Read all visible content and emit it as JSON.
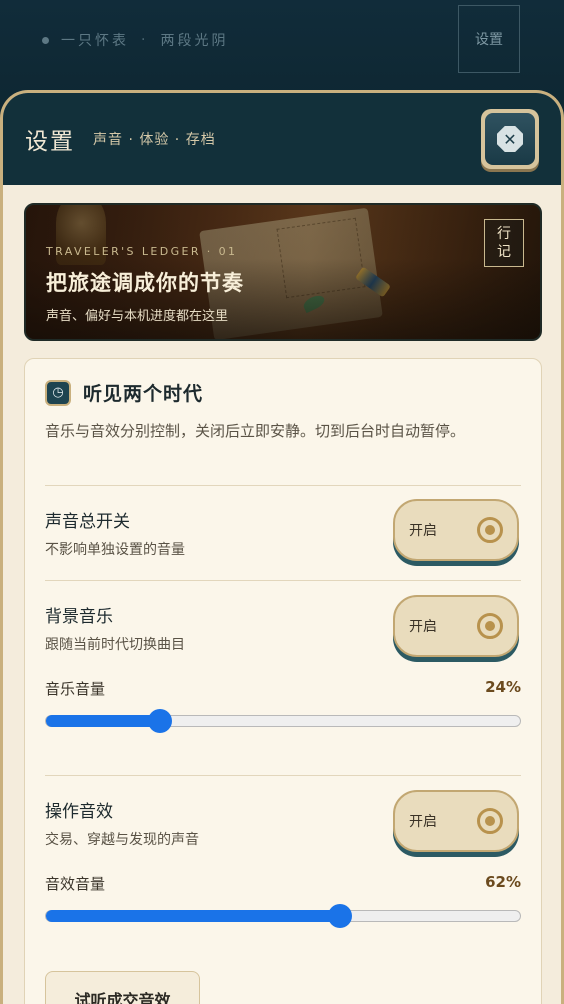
{
  "topbar": {
    "crumb_a": "一只怀表",
    "crumb_sep": "·",
    "crumb_b": "两段光阴",
    "settings_label": "设置"
  },
  "sheet": {
    "title": "设置",
    "subtitle": "声音 · 体验 · 存档",
    "close_icon": "close-icon"
  },
  "banner": {
    "eyebrow": "TRAVELER'S LEDGER · 01",
    "headline": "把旅途调成你的节奏",
    "desc": "声音、偏好与本机进度都在这里",
    "stamp_top": "行",
    "stamp_bottom": "记"
  },
  "card": {
    "title": "听见两个时代",
    "desc": "音乐与音效分别控制，关闭后立即安静。切到后台时自动暂停。",
    "master": {
      "title": "声音总开关",
      "sub": "不影响单独设置的音量",
      "toggle_label": "开启"
    },
    "music": {
      "title": "背景音乐",
      "sub": "跟随当前时代切换曲目",
      "toggle_label": "开启",
      "volume_label": "音乐音量",
      "volume_text": "24%",
      "volume": 0.24
    },
    "sfx": {
      "title": "操作音效",
      "sub": "交易、穿越与发现的声音",
      "toggle_label": "开启",
      "volume_label": "音效音量",
      "volume_text": "62%",
      "volume": 0.62
    },
    "test_button": "试听成交音效"
  },
  "colors": {
    "accent_blue": "#1a73e8",
    "header_teal": "#12303a",
    "gold_border": "#c9b07e"
  }
}
